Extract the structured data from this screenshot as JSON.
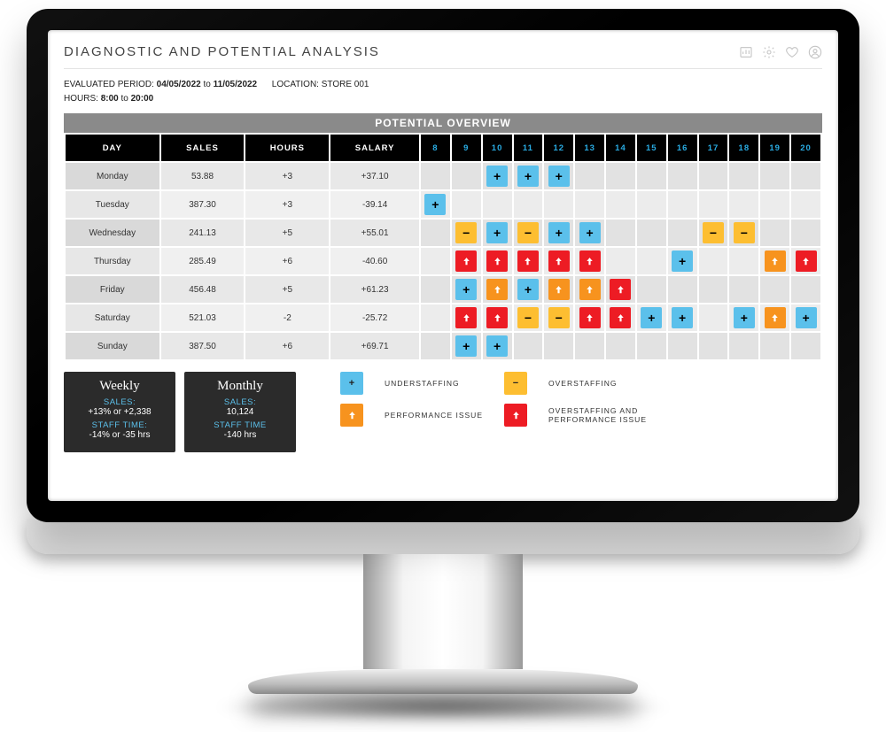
{
  "title": "DIAGNOSTIC AND POTENTIAL ANALYSIS",
  "meta": {
    "evaluated_label": "EVALUATED PERIOD:",
    "date_from": "04/05/2022",
    "to": "to",
    "date_to": "11/05/2022",
    "location_label": "LOCATION:",
    "location": "STORE 001",
    "hours_label": "HOURS:",
    "hour_from": "8:00",
    "hour_to": "20:00"
  },
  "banner": "POTENTIAL OVERVIEW",
  "columns": {
    "day": "DAY",
    "sales": "SALES",
    "hours": "HOURS",
    "salary": "SALARY"
  },
  "hours": [
    "8",
    "9",
    "10",
    "11",
    "12",
    "13",
    "14",
    "15",
    "16",
    "17",
    "18",
    "19",
    "20"
  ],
  "rows": [
    {
      "day": "Monday",
      "sales": "53.88",
      "hours": "+3",
      "salary": "+37.10",
      "slots": [
        "",
        "",
        "U",
        "U",
        "U",
        "",
        "",
        "",
        "",
        "",
        "",
        "",
        ""
      ]
    },
    {
      "day": "Tuesday",
      "sales": "387.30",
      "hours": "+3",
      "salary": "-39.14",
      "slots": [
        "U",
        "",
        "",
        "",
        "",
        "",
        "",
        "",
        "",
        "",
        "",
        "",
        ""
      ]
    },
    {
      "day": "Wednesday",
      "sales": "241.13",
      "hours": "+5",
      "salary": "+55.01",
      "slots": [
        "",
        "O",
        "U",
        "O",
        "U",
        "U",
        "",
        "",
        "",
        "O",
        "O",
        "",
        ""
      ]
    },
    {
      "day": "Thursday",
      "sales": "285.49",
      "hours": "+6",
      "salary": "-40.60",
      "slots": [
        "",
        "R",
        "R",
        "R",
        "R",
        "R",
        "",
        "",
        "U",
        "",
        "",
        "P",
        "R"
      ]
    },
    {
      "day": "Friday",
      "sales": "456.48",
      "hours": "+5",
      "salary": "+61.23",
      "slots": [
        "",
        "U",
        "P",
        "U",
        "P",
        "P",
        "R",
        "",
        "",
        "",
        "",
        "",
        ""
      ]
    },
    {
      "day": "Saturday",
      "sales": "521.03",
      "hours": "-2",
      "salary": "-25.72",
      "slots": [
        "",
        "R",
        "R",
        "O",
        "O",
        "R",
        "R",
        "U",
        "U",
        "",
        "U",
        "P",
        "U"
      ]
    },
    {
      "day": "Sunday",
      "sales": "387.50",
      "hours": "+6",
      "salary": "+69.71",
      "slots": [
        "",
        "U",
        "U",
        "",
        "",
        "",
        "",
        "",
        "",
        "",
        "",
        "",
        ""
      ]
    }
  ],
  "legend": {
    "under": "UNDERSTAFFING",
    "over": "OVERSTAFFING",
    "perf": "PERFORMANCE ISSUE",
    "both": "OVERSTAFFING AND PERFORMANCE ISSUE"
  },
  "cards": {
    "weekly": {
      "title": "Weekly",
      "sales_k": "SALES:",
      "sales_v": "+13% or +2,338",
      "time_k": "STAFF TIME:",
      "time_v": "-14% or -35 hrs"
    },
    "monthly": {
      "title": "Monthly",
      "sales_k": "SALES:",
      "sales_v": "10,124",
      "time_k": "STAFF TIME",
      "time_v": "-140 hrs"
    }
  },
  "glyph": {
    "plus": "+",
    "minus": "−"
  }
}
